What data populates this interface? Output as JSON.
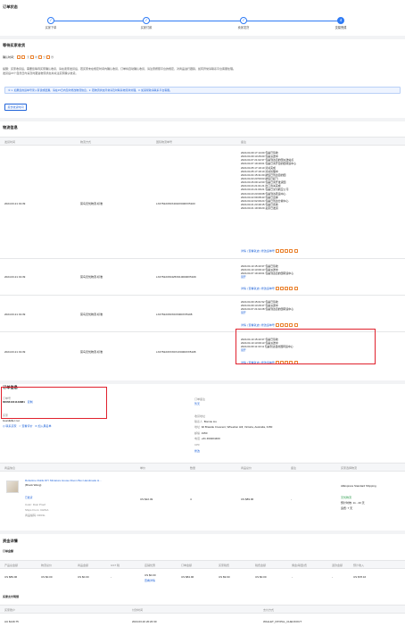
{
  "order_status": {
    "title": "订单状态",
    "steps": [
      "买家下单",
      "买家付款",
      "卖家发货",
      "交易完成"
    ]
  },
  "waiting": {
    "title": "等待买家收货",
    "countdown_label": "确认时间：",
    "countdown_boxes": [
      "",
      ""
    ],
    "desc1": "提醒：买家收货后，需要您等待买家确认收货，请在卖家发货后，若买家未在规定时间内确认收货，订单将自动确认收货，请注意按照平台的规定，对商品进行跟踪，如有异常请联系平台客服处理。",
    "desc2": "发货后15个自然日内请及时跟进物流状态并关注买家确认收货。",
    "notice": "① 1. 如果您的运单号录入有误或遗漏，请在15日内及时修改物流信息，2. 若物流状态异常请及时联系物流商处理，3. 如需帮助请联系平台客服。",
    "button": "延长收货时间"
  },
  "logistics": {
    "title": "物流信息",
    "headers": [
      "发货时间",
      "物流方式",
      "国际物流单号",
      "备注"
    ],
    "actions_text": "详情 | 查看轨迹 | 修改运单号",
    "rows": [
      {
        "time": "2024.03.21 19:39",
        "method": "菜鸟无忧物流-标准",
        "tracking": "LX475223X0X4010X000XX5103",
        "events": [
          "2024.04.09 17:14:00 包裹已签收",
          "2024.04.09 13:26:00 包裹派送中",
          "2024.04.07 21:02:37 包裹到达目的国派送站点",
          "2024.04.07 19:40:01 包裹已离开目的国转运中心",
          "2024.04.05 17:19:10 清关完成",
          "2024.04.05 17:19:10 清关处理中",
          "2024.04.04 15:31:00 航班已到达目的国",
          "2024.04.03 23:50:03 航班已起飞",
          "2024.03.26 09:12:00 包裹已离开发货国",
          "2024.03.24 21:01:21 出口清关完成",
          "2024.03.24 21:09:21 包裹已交付航空公司",
          "2024.03.23 23:09:08 包裹到达转运中心",
          "2024.03.22 09:08:43 包裹已出库",
          "2024.03.22 02:09:24 包裹已到达分拨中心",
          "2024.03.21 23:49:15 包裹已揽收",
          "2024.03.21 19:39:20 卖家已发货"
        ]
      },
      {
        "time": "2024.03.21 19:39",
        "method": "菜鸟无忧物流-标准",
        "tracking": "LX475223X0425X0100000X5109",
        "events": [
          "2024.04.10 15:43:37 包裹已签收",
          "2024.04.10 13:09:13 包裹派送中",
          "2024.04.07 19:40:01 包裹到达目的国转运中心",
          "展开"
        ]
      },
      {
        "time": "2024.03.21 19:39",
        "method": "菜鸟无忧物流-标准",
        "tracking": "LX475223X0X03X000XX5108",
        "events": [
          "2024.04.09 15:01:52 包裹已签收",
          "2024.04.09 13:29:47 包裹派送中",
          "2024.04.07 21:02:28 包裹到达目的国转运中心",
          "展开"
        ]
      },
      {
        "time": "2024.03.21 19:39",
        "method": "菜鸟无忧物流-标准",
        "tracking": "LX475223XXX0X1X0000XX5108",
        "events": [
          "2024.04.10 15:43:37 包裹已签收",
          "2024.04.10 13:09:13 包裹派送中",
          "2024.04.09 11:13:11 包裹到达目的国转运中心",
          "展开"
        ]
      }
    ]
  },
  "order_info": {
    "title": "订单信息",
    "order_no_label": "订单号",
    "order_no": "800661041149881",
    "copy": "复制",
    "buyer_label": "买家",
    "buyer": "boardkiller nut",
    "actions": [
      "联系买家",
      "查看评价",
      "加入黑名单"
    ],
    "shipping_title": "订单备注",
    "shipping_value": "暂无",
    "address_title": "收货地址",
    "contact_label": "联系人",
    "contact": "Bonnie Liu",
    "address_label": "地址",
    "address": "92 Braside Crescent, Wheelton Hill, Victoria, Australia, 3150",
    "zip_label": "邮编",
    "zip": "3150",
    "phone_label": "电话",
    "phone": "+61 460204400",
    "cpf_label": "CPF",
    "cpf": "",
    "edit": "修改"
  },
  "products": {
    "headers": [
      "商品信息",
      "单价",
      "数量",
      "商品总价",
      "备注",
      "买家选择物流"
    ],
    "name": "Robotime Rolife DIY Miniature House Room Box Handmade H...",
    "sub": "(Brook Wang)",
    "meta": [
      "Color: Dust Proof",
      "Ships From: CHINA",
      "商品编码: DF03L"
    ],
    "tag": "已发货",
    "unit_price": "US $22.49",
    "qty": "4",
    "total": "US $89.96",
    "remark": "-",
    "logistics_name": "AliExpress Standard Shipping",
    "logistics_tag": "无忧物流",
    "logistics_days": "预计时效: 11 - 20 天",
    "logistics_fee": "运费: 7 天"
  },
  "funds": {
    "title": "资金详情",
    "sub": "订单金额",
    "headers": [
      "产品总金额",
      "物流总价",
      "商品金额",
      "GST 税",
      "店铺优惠",
      "订单金额",
      "买家税费",
      "税费金额",
      "佣金(联盟)费",
      "退款金额",
      "预计收入"
    ],
    "values": [
      "US $89.96",
      "US $0.00",
      "US $0.00",
      "-",
      "US $0.00",
      "US $84.96",
      "US $9.90",
      "US $0.00",
      "-",
      "-",
      "US $78.16"
    ],
    "coupon_link": "查看详情"
  },
  "payment": {
    "title": "买家支付明细",
    "headers": [
      "买家账户",
      "付款时间",
      "支付方式"
    ],
    "values": [
      "AU $149.75",
      "2024.03.20 20:20:30",
      "WALLET_PAYPAL_CHECKOUT"
    ]
  }
}
